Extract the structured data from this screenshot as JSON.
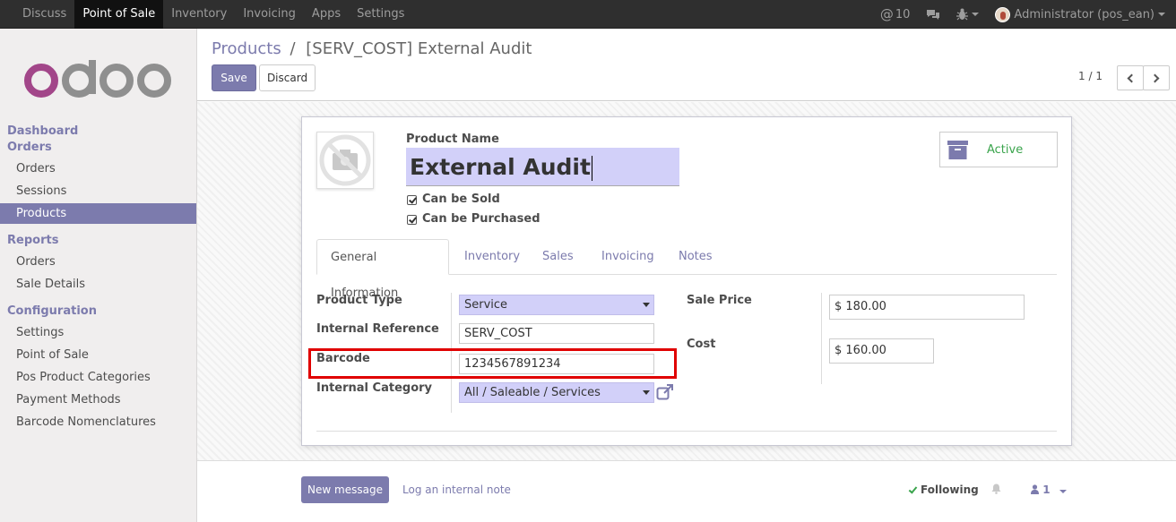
{
  "topbar": {
    "menu": [
      "Discuss",
      "Point of Sale",
      "Inventory",
      "Invoicing",
      "Apps",
      "Settings"
    ],
    "active_index": 1,
    "mentions": "10",
    "user": "Administrator (pos_ean)"
  },
  "sidebar": {
    "headings": {
      "dashboard": "Dashboard",
      "orders": "Orders",
      "reports": "Reports",
      "configuration": "Configuration"
    },
    "orders_items": [
      "Orders",
      "Sessions",
      "Products"
    ],
    "reports_items": [
      "Orders",
      "Sale Details"
    ],
    "configuration_items": [
      "Settings",
      "Point of Sale",
      "Pos Product Categories",
      "Payment Methods",
      "Barcode Nomenclatures"
    ]
  },
  "control": {
    "breadcrumb_parent": "Products",
    "breadcrumb_sep": "/",
    "breadcrumb_current": "[SERV_COST] External Audit",
    "save_label": "Save",
    "discard_label": "Discard",
    "pager": "1 / 1"
  },
  "form": {
    "product_name_label": "Product Name",
    "product_name": "External Audit",
    "can_be_sold": "Can be Sold",
    "can_be_purchased": "Can be Purchased",
    "active_label": "Active",
    "tabs": [
      "General Information",
      "Inventory",
      "Sales",
      "Invoicing",
      "Notes"
    ],
    "product_type_label": "Product Type",
    "product_type": "Service",
    "internal_reference_label": "Internal Reference",
    "internal_reference": "SERV_COST",
    "barcode_label": "Barcode",
    "barcode": "1234567891234",
    "internal_category_label": "Internal Category",
    "internal_category": "All / Saleable / Services",
    "sale_price_label": "Sale Price",
    "sale_price": "$ 180.00",
    "cost_label": "Cost",
    "cost": "$ 160.00"
  },
  "chatter": {
    "new_message": "New message",
    "log_note": "Log an internal note",
    "following": "Following",
    "followers_count": "1"
  },
  "colors": {
    "brand": "#7c7bad",
    "required_field": "#d2d0f9",
    "highlight": "#e00000",
    "active_green": "#3aa44c"
  }
}
